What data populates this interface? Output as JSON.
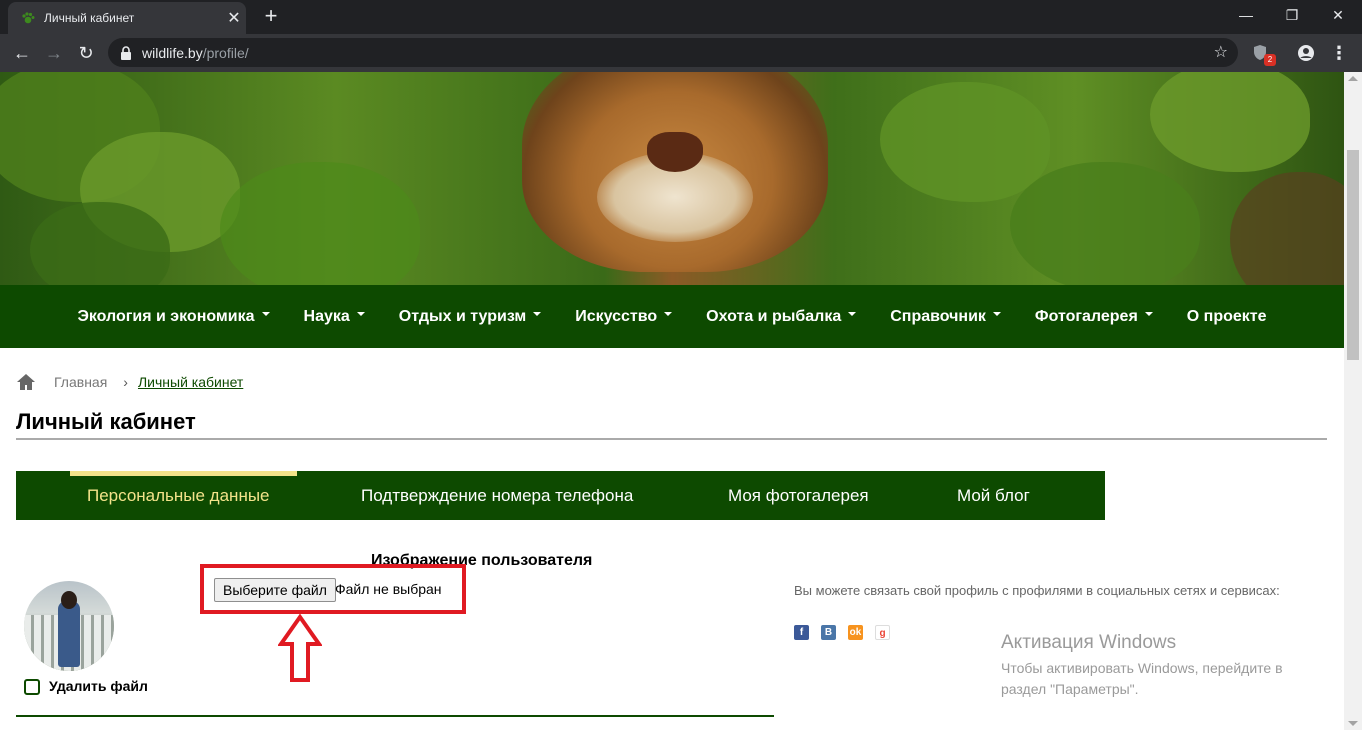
{
  "browser": {
    "tab_title": "Личный кабинет",
    "url_host": "wildlife.by",
    "url_path": "/profile/",
    "extension_badge": "2"
  },
  "colors": {
    "nav_green": "#0d4a00",
    "active_tab_yellow": "#f3e38a",
    "highlight_red": "#e01a22"
  },
  "main_nav": {
    "items": [
      {
        "label": "Экология и экономика",
        "has_dropdown": true
      },
      {
        "label": "Наука",
        "has_dropdown": true
      },
      {
        "label": "Отдых и туризм",
        "has_dropdown": true
      },
      {
        "label": "Искусство",
        "has_dropdown": true
      },
      {
        "label": "Охота и рыбалка",
        "has_dropdown": true
      },
      {
        "label": "Справочник",
        "has_dropdown": true
      },
      {
        "label": "Фотогалерея",
        "has_dropdown": true
      },
      {
        "label": "О проекте",
        "has_dropdown": false
      }
    ]
  },
  "breadcrumb": {
    "home_label": "Главная",
    "current": "Личный кабинет"
  },
  "page": {
    "title": "Личный кабинет"
  },
  "profile_tabs": {
    "items": [
      {
        "label": "Персональные данные",
        "active": true
      },
      {
        "label": "Подтверждение номера телефона",
        "active": false
      },
      {
        "label": "Моя фотогалерея",
        "active": false
      },
      {
        "label": "Мой блог",
        "active": false
      }
    ]
  },
  "avatar_section": {
    "title": "Изображение пользователя",
    "choose_file_label": "Выберите файл",
    "file_status": "Файл не выбран",
    "delete_label": "Удалить файл",
    "delete_checked": false
  },
  "social": {
    "text": "Вы можете связать свой профиль с профилями в социальных сетях и сервисах:",
    "icons": [
      "facebook-icon",
      "vkontakte-icon",
      "odnoklassniki-icon",
      "google-icon"
    ]
  },
  "windows_activation": {
    "heading": "Активация Windows",
    "line1": "Чтобы активировать Windows, перейдите в",
    "line2": "раздел \"Параметры\"."
  }
}
